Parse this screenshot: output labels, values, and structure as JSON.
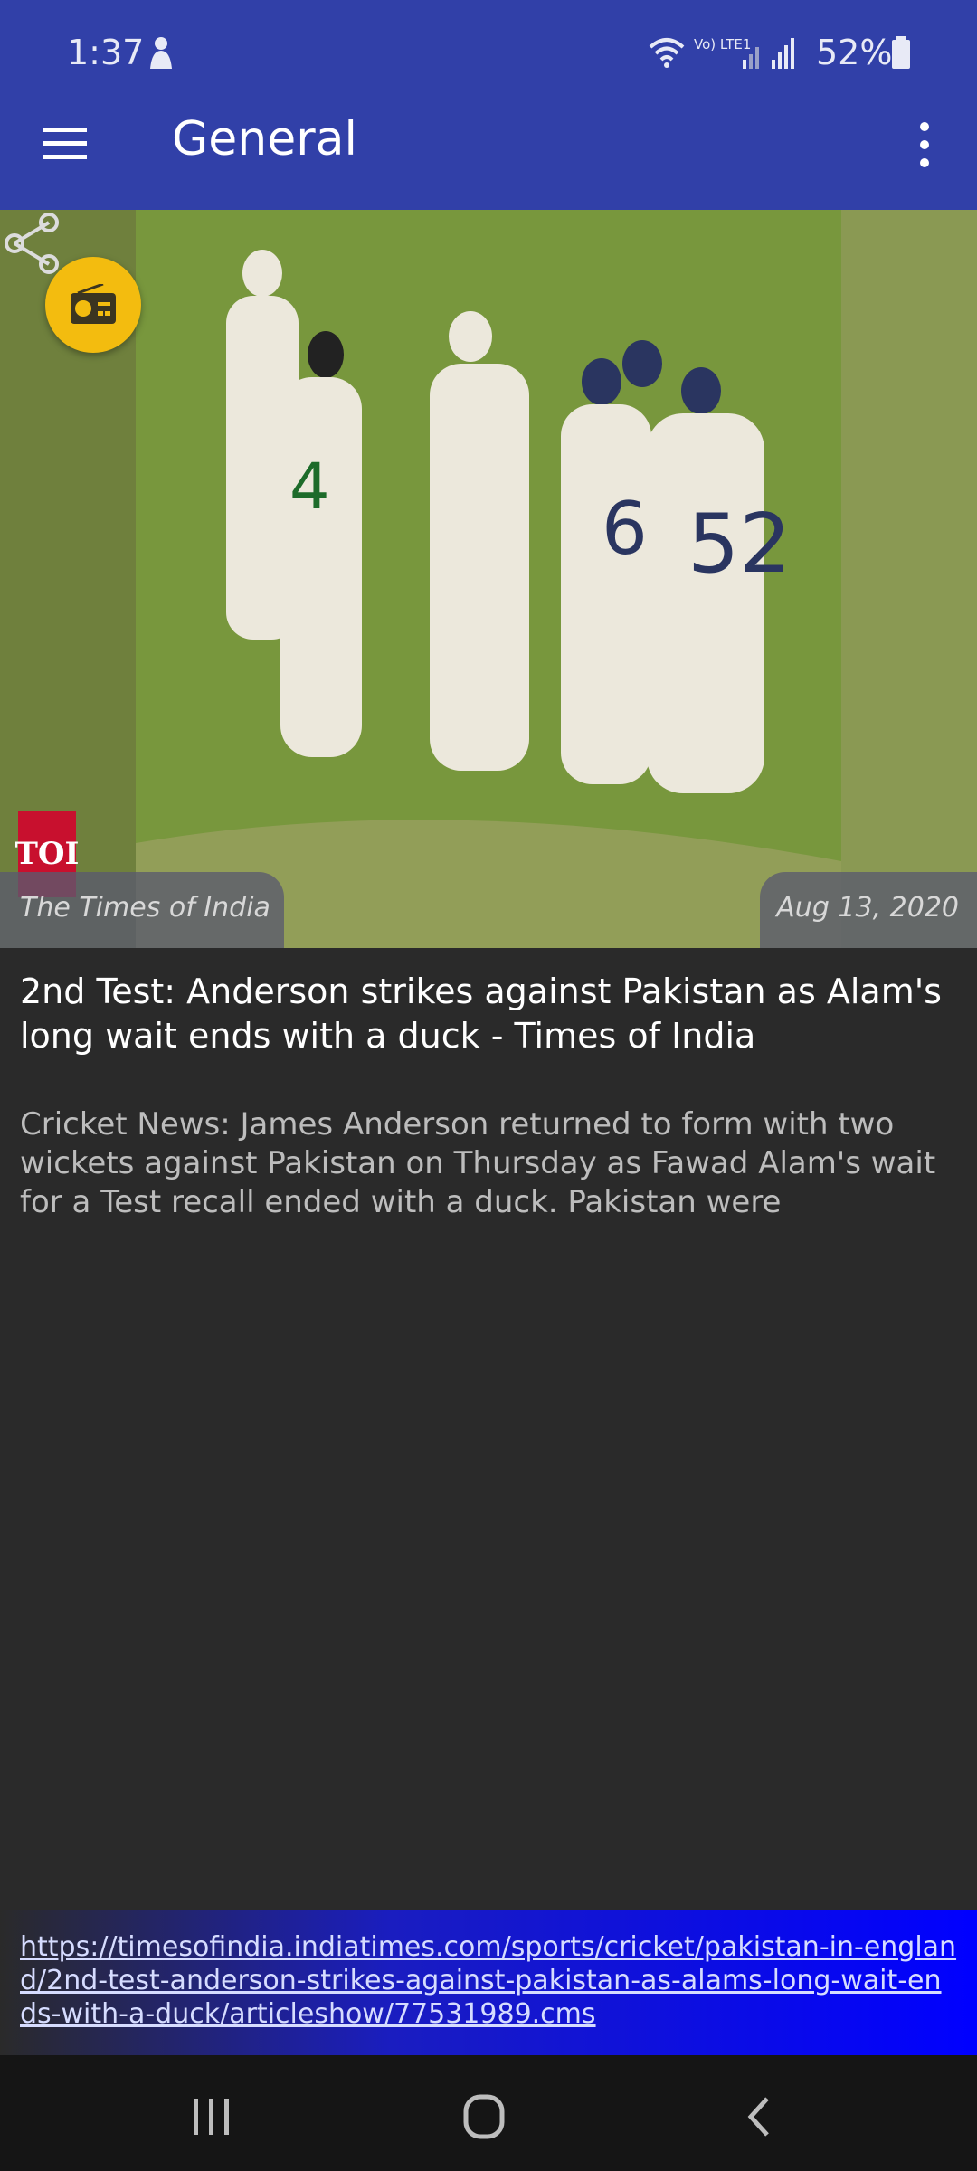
{
  "status_bar": {
    "time": "1:37",
    "network_label": "Vo) LTE1",
    "battery": "52%"
  },
  "app_bar": {
    "title": "General",
    "menu_icon": "hamburger-menu-icon",
    "overflow_icon": "more-vert-icon",
    "background": "#3140a8"
  },
  "article": {
    "image_alt": "England cricket team celebrating a wicket against Pakistan",
    "radio_icon": "radio-icon",
    "share_icon": "share-icon",
    "source_logo_text": "TOI",
    "source": "The Times of India",
    "date": "Aug 13, 2020",
    "headline": "2nd Test: Anderson strikes against Pakistan as Alam's long wait ends with a duck - Times of India",
    "description": "Cricket News: James Anderson returned to form with two wickets against Pakistan on Thursday as Fawad Alam's wait for a Test recall ended with a duck. Pakistan were",
    "url": "https://timesofindia.indiatimes.com/sports/cricket/pakistan-in-england/2nd-test-anderson-strikes-against-pakistan-as-alams-long-wait-ends-with-a-duck/articleshow/77531989.cms"
  },
  "nav_bar": {
    "recents_icon": "recents-icon",
    "home_icon": "home-icon",
    "back_icon": "back-icon"
  }
}
